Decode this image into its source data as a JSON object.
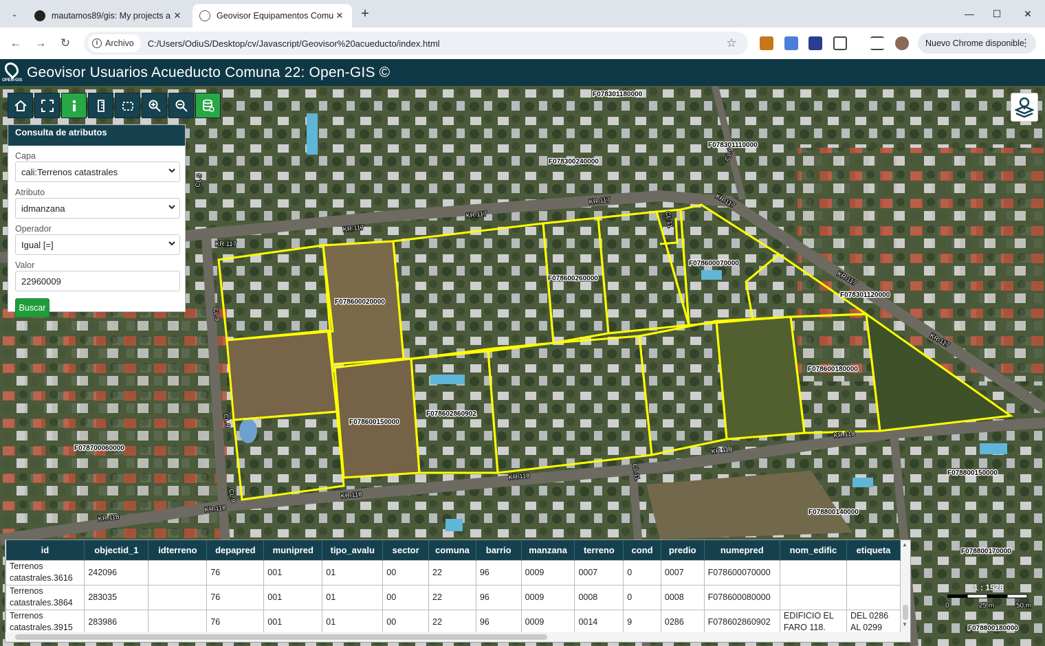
{
  "browser": {
    "tabs": [
      {
        "title": "mautamos89/gis: My projects a",
        "favicon": "github-icon"
      },
      {
        "title": "Geovisor Equipamentos Comun",
        "favicon": "globe-icon"
      }
    ],
    "site_chip": "Archivo",
    "url": "C:/Users/OdiuS/Desktop/cv/Javascript/Geovisor%20acueducto/index.html",
    "update_button": "Nuevo Chrome disponible"
  },
  "app": {
    "title": "Geovisor Usuarios Acueducto Comuna 22: Open-GIS ©",
    "logo_text": "OPEN-GIS"
  },
  "toolbar_tools": [
    "home-icon",
    "fullscreen-icon",
    "info-icon",
    "measure-length-icon",
    "measure-area-icon",
    "zoom-in-icon",
    "zoom-out-icon",
    "database-query-icon"
  ],
  "query": {
    "title": "Consulta de atributos",
    "capa_label": "Capa",
    "capa_value": "cali:Terrenos catastrales",
    "atributo_label": "Atributo",
    "atributo_value": "idmanzana",
    "operador_label": "Operador",
    "operador_value": "Igual [=]",
    "valor_label": "Valor",
    "valor_value": "22960009",
    "buscar": "Buscar"
  },
  "map_labels": {
    "parcels": [
      "F078301180000",
      "F078301110000",
      "F078300240000",
      "F078600020000",
      "F078600260000",
      "F078600070000",
      "F078301120000",
      "F078600180000",
      "F078602860902",
      "F078600150000",
      "F078700060000",
      "F078800150000",
      "F078800140000",
      "F078800170000",
      "F078800180000"
    ],
    "roads": [
      "KR 117",
      "KR 117",
      "KR 117",
      "KR 117",
      "KR 117",
      "KR 117",
      "KR 117",
      "KR 118",
      "KR 118",
      "KR 118",
      "KR 118",
      "KR 118",
      "KR 118",
      "CL 9",
      "CL 9",
      "CL 9",
      "CL 9",
      "CL 11",
      "CL 11",
      "CL 9"
    ]
  },
  "scale": {
    "ratio": "1 : 1528",
    "ticks": [
      "0",
      "25 m",
      "50 m"
    ]
  },
  "table": {
    "columns": [
      "id",
      "objectid_1",
      "idterreno",
      "depapred",
      "munipred",
      "tipo_avalu",
      "sector",
      "comuna",
      "barrio",
      "manzana",
      "terreno",
      "cond",
      "predio",
      "numepred",
      "nom_edific",
      "etiqueta"
    ],
    "rows": [
      [
        "Terrenos catastrales.3616",
        "242096",
        "",
        "76",
        "001",
        "01",
        "00",
        "22",
        "96",
        "0009",
        "0007",
        "0",
        "0007",
        "F078600070000",
        "",
        ""
      ],
      [
        "Terrenos catastrales.3864",
        "283035",
        "",
        "76",
        "001",
        "01",
        "00",
        "22",
        "96",
        "0009",
        "0008",
        "0",
        "0008",
        "F078600080000",
        "",
        ""
      ],
      [
        "Terrenos catastrales.3915",
        "283986",
        "",
        "76",
        "001",
        "01",
        "00",
        "22",
        "96",
        "0009",
        "0014",
        "9",
        "0286",
        "F078602860902",
        "EDIFICIO EL FARO 118.",
        "DEL 0286 AL 0299"
      ]
    ]
  },
  "colors": {
    "header": "#0f3846",
    "highlight": "#ffff00",
    "button": "#1f9d3a"
  }
}
